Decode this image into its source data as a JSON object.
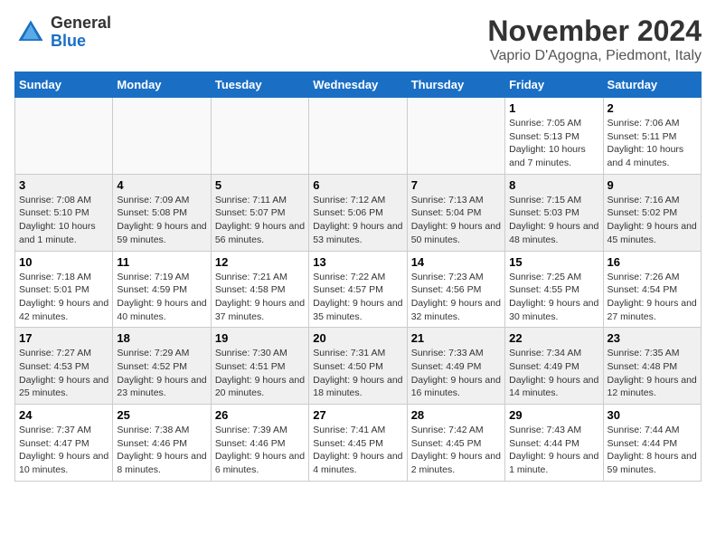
{
  "header": {
    "logo_general": "General",
    "logo_blue": "Blue",
    "month_title": "November 2024",
    "location": "Vaprio D'Agogna, Piedmont, Italy"
  },
  "days_of_week": [
    "Sunday",
    "Monday",
    "Tuesday",
    "Wednesday",
    "Thursday",
    "Friday",
    "Saturday"
  ],
  "weeks": [
    [
      {
        "day": "",
        "info": ""
      },
      {
        "day": "",
        "info": ""
      },
      {
        "day": "",
        "info": ""
      },
      {
        "day": "",
        "info": ""
      },
      {
        "day": "",
        "info": ""
      },
      {
        "day": "1",
        "info": "Sunrise: 7:05 AM\nSunset: 5:13 PM\nDaylight: 10 hours and 7 minutes."
      },
      {
        "day": "2",
        "info": "Sunrise: 7:06 AM\nSunset: 5:11 PM\nDaylight: 10 hours and 4 minutes."
      }
    ],
    [
      {
        "day": "3",
        "info": "Sunrise: 7:08 AM\nSunset: 5:10 PM\nDaylight: 10 hours and 1 minute."
      },
      {
        "day": "4",
        "info": "Sunrise: 7:09 AM\nSunset: 5:08 PM\nDaylight: 9 hours and 59 minutes."
      },
      {
        "day": "5",
        "info": "Sunrise: 7:11 AM\nSunset: 5:07 PM\nDaylight: 9 hours and 56 minutes."
      },
      {
        "day": "6",
        "info": "Sunrise: 7:12 AM\nSunset: 5:06 PM\nDaylight: 9 hours and 53 minutes."
      },
      {
        "day": "7",
        "info": "Sunrise: 7:13 AM\nSunset: 5:04 PM\nDaylight: 9 hours and 50 minutes."
      },
      {
        "day": "8",
        "info": "Sunrise: 7:15 AM\nSunset: 5:03 PM\nDaylight: 9 hours and 48 minutes."
      },
      {
        "day": "9",
        "info": "Sunrise: 7:16 AM\nSunset: 5:02 PM\nDaylight: 9 hours and 45 minutes."
      }
    ],
    [
      {
        "day": "10",
        "info": "Sunrise: 7:18 AM\nSunset: 5:01 PM\nDaylight: 9 hours and 42 minutes."
      },
      {
        "day": "11",
        "info": "Sunrise: 7:19 AM\nSunset: 4:59 PM\nDaylight: 9 hours and 40 minutes."
      },
      {
        "day": "12",
        "info": "Sunrise: 7:21 AM\nSunset: 4:58 PM\nDaylight: 9 hours and 37 minutes."
      },
      {
        "day": "13",
        "info": "Sunrise: 7:22 AM\nSunset: 4:57 PM\nDaylight: 9 hours and 35 minutes."
      },
      {
        "day": "14",
        "info": "Sunrise: 7:23 AM\nSunset: 4:56 PM\nDaylight: 9 hours and 32 minutes."
      },
      {
        "day": "15",
        "info": "Sunrise: 7:25 AM\nSunset: 4:55 PM\nDaylight: 9 hours and 30 minutes."
      },
      {
        "day": "16",
        "info": "Sunrise: 7:26 AM\nSunset: 4:54 PM\nDaylight: 9 hours and 27 minutes."
      }
    ],
    [
      {
        "day": "17",
        "info": "Sunrise: 7:27 AM\nSunset: 4:53 PM\nDaylight: 9 hours and 25 minutes."
      },
      {
        "day": "18",
        "info": "Sunrise: 7:29 AM\nSunset: 4:52 PM\nDaylight: 9 hours and 23 minutes."
      },
      {
        "day": "19",
        "info": "Sunrise: 7:30 AM\nSunset: 4:51 PM\nDaylight: 9 hours and 20 minutes."
      },
      {
        "day": "20",
        "info": "Sunrise: 7:31 AM\nSunset: 4:50 PM\nDaylight: 9 hours and 18 minutes."
      },
      {
        "day": "21",
        "info": "Sunrise: 7:33 AM\nSunset: 4:49 PM\nDaylight: 9 hours and 16 minutes."
      },
      {
        "day": "22",
        "info": "Sunrise: 7:34 AM\nSunset: 4:49 PM\nDaylight: 9 hours and 14 minutes."
      },
      {
        "day": "23",
        "info": "Sunrise: 7:35 AM\nSunset: 4:48 PM\nDaylight: 9 hours and 12 minutes."
      }
    ],
    [
      {
        "day": "24",
        "info": "Sunrise: 7:37 AM\nSunset: 4:47 PM\nDaylight: 9 hours and 10 minutes."
      },
      {
        "day": "25",
        "info": "Sunrise: 7:38 AM\nSunset: 4:46 PM\nDaylight: 9 hours and 8 minutes."
      },
      {
        "day": "26",
        "info": "Sunrise: 7:39 AM\nSunset: 4:46 PM\nDaylight: 9 hours and 6 minutes."
      },
      {
        "day": "27",
        "info": "Sunrise: 7:41 AM\nSunset: 4:45 PM\nDaylight: 9 hours and 4 minutes."
      },
      {
        "day": "28",
        "info": "Sunrise: 7:42 AM\nSunset: 4:45 PM\nDaylight: 9 hours and 2 minutes."
      },
      {
        "day": "29",
        "info": "Sunrise: 7:43 AM\nSunset: 4:44 PM\nDaylight: 9 hours and 1 minute."
      },
      {
        "day": "30",
        "info": "Sunrise: 7:44 AM\nSunset: 4:44 PM\nDaylight: 8 hours and 59 minutes."
      }
    ]
  ]
}
